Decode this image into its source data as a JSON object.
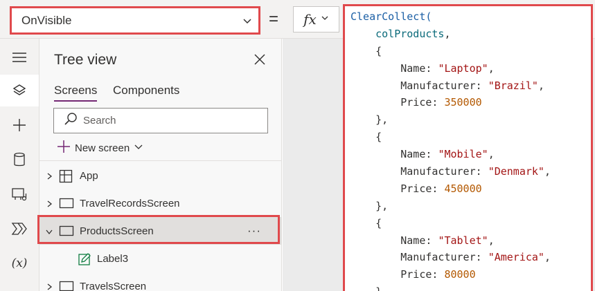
{
  "formula_bar": {
    "property": "OnVisible",
    "equals": "=",
    "fx_label": "fx"
  },
  "left_rail": {
    "items": [
      {
        "name": "hamburger-menu-icon",
        "active": false
      },
      {
        "name": "tree-view-layers-icon",
        "active": true
      },
      {
        "name": "insert-plus-icon",
        "active": false
      },
      {
        "name": "data-database-icon",
        "active": false
      },
      {
        "name": "media-icon",
        "active": false
      },
      {
        "name": "power-automate-icon",
        "active": false
      },
      {
        "name": "variables-icon",
        "active": false,
        "label": "(x)"
      }
    ]
  },
  "tree_view": {
    "title": "Tree view",
    "tabs": [
      "Screens",
      "Components"
    ],
    "active_tab": "Screens",
    "search_placeholder": "Search",
    "new_screen_label": "New screen",
    "items": [
      {
        "label": "App",
        "icon": "app-icon",
        "expander": "chevron-right"
      },
      {
        "label": "TravelRecordsScreen",
        "icon": "screen-icon",
        "expander": "chevron-right"
      },
      {
        "label": "ProductsScreen",
        "icon": "screen-icon",
        "expander": "chevron-down",
        "selected": true
      },
      {
        "label": "Label3",
        "icon": "label-edit-icon",
        "child": true
      },
      {
        "label": "TravelsScreen",
        "icon": "screen-icon",
        "expander": "chevron-right"
      }
    ],
    "more_label": "···"
  },
  "code": {
    "lines": [
      [
        {
          "t": "ClearCollect(",
          "c": "fn"
        }
      ],
      [
        {
          "t": "    colProducts",
          "c": "id"
        },
        {
          "t": ",",
          "c": "pun"
        }
      ],
      [
        {
          "t": "    {",
          "c": "pun"
        }
      ],
      [
        {
          "t": "        Name: ",
          "c": "key"
        },
        {
          "t": "\"Laptop\"",
          "c": "str"
        },
        {
          "t": ",",
          "c": "pun"
        }
      ],
      [
        {
          "t": "        Manufacturer: ",
          "c": "key"
        },
        {
          "t": "\"Brazil\"",
          "c": "str"
        },
        {
          "t": ",",
          "c": "pun"
        }
      ],
      [
        {
          "t": "        Price: ",
          "c": "key"
        },
        {
          "t": "350000",
          "c": "num"
        }
      ],
      [
        {
          "t": "    },",
          "c": "pun"
        }
      ],
      [
        {
          "t": "    {",
          "c": "pun"
        }
      ],
      [
        {
          "t": "        Name: ",
          "c": "key"
        },
        {
          "t": "\"Mobile\"",
          "c": "str"
        },
        {
          "t": ",",
          "c": "pun"
        }
      ],
      [
        {
          "t": "        Manufacturer: ",
          "c": "key"
        },
        {
          "t": "\"Denmark\"",
          "c": "str"
        },
        {
          "t": ",",
          "c": "pun"
        }
      ],
      [
        {
          "t": "        Price: ",
          "c": "key"
        },
        {
          "t": "450000",
          "c": "num"
        }
      ],
      [
        {
          "t": "    },",
          "c": "pun"
        }
      ],
      [
        {
          "t": "    {",
          "c": "pun"
        }
      ],
      [
        {
          "t": "        Name: ",
          "c": "key"
        },
        {
          "t": "\"Tablet\"",
          "c": "str"
        },
        {
          "t": ",",
          "c": "pun"
        }
      ],
      [
        {
          "t": "        Manufacturer: ",
          "c": "key"
        },
        {
          "t": "\"America\"",
          "c": "str"
        },
        {
          "t": ",",
          "c": "pun"
        }
      ],
      [
        {
          "t": "        Price: ",
          "c": "key"
        },
        {
          "t": "80000",
          "c": "num"
        }
      ],
      [
        {
          "t": "    }",
          "c": "pun"
        }
      ]
    ]
  },
  "colors": {
    "highlight_border": "#e0494c",
    "accent": "#742774"
  }
}
